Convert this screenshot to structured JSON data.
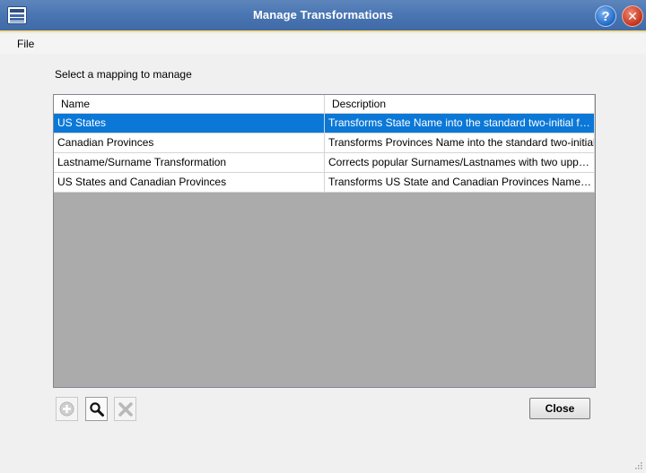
{
  "window": {
    "title": "Manage Transformations",
    "help_label": "?",
    "close_label": "✕"
  },
  "menu": {
    "file": "File"
  },
  "prompt": "Select a mapping to manage",
  "grid": {
    "columns": [
      "Name",
      "Description"
    ],
    "rows": [
      {
        "name": "US States",
        "description": "Transforms State Name into the standard two-initial format.",
        "selected": true
      },
      {
        "name": "Canadian Provinces",
        "description": "Transforms Provinces Name into the standard two-initial format",
        "selected": false
      },
      {
        "name": "Lastname/Surname Transformation",
        "description": "Corrects popular Surnames/Lastnames with two upper-case letters",
        "selected": false
      },
      {
        "name": "US States and Canadian Provinces",
        "description": "Transforms US State and Canadian Provinces Names into standard two-initial format",
        "selected": false
      }
    ]
  },
  "toolbar": {
    "add_icon": "add-circle-icon",
    "view_icon": "magnifier-icon",
    "delete_icon": "delete-x-icon"
  },
  "buttons": {
    "close": "Close"
  },
  "colors": {
    "title_bar": "#4a76b3",
    "selection": "#0b78d7",
    "grid_empty": "#ababab"
  }
}
